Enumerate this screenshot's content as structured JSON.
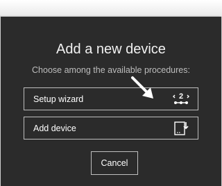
{
  "dialog": {
    "title": "Add a new device",
    "subtitle": "Choose among the available procedures:"
  },
  "options": [
    {
      "label": "Setup wizard",
      "icon": "wizard-step-icon"
    },
    {
      "label": "Add device",
      "icon": "add-device-icon"
    }
  ],
  "cancel_label": "Cancel",
  "wizard_icon_text": "2",
  "colors": {
    "dialog_bg": "#2b2b2b",
    "border": "#bfbfbf",
    "text": "#ffffff",
    "subtitle": "#bdbdbd"
  }
}
